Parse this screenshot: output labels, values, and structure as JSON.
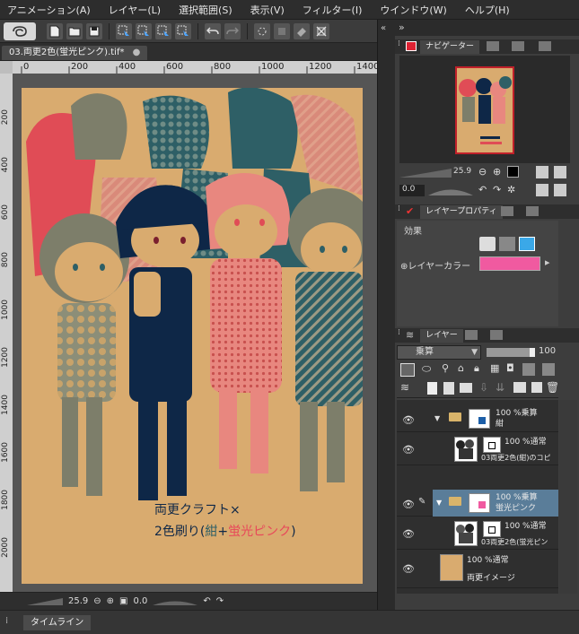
{
  "menu": [
    "アニメーション(A)",
    "レイヤー(L)",
    "選択範囲(S)",
    "表示(V)",
    "フィルター(I)",
    "ウインドウ(W)",
    "ヘルプ(H)"
  ],
  "document": {
    "tab_title": "03.両更2色(蛍光ピンク).tif*",
    "tab_close": "●"
  },
  "ruler_top_labels": [
    "0",
    "200",
    "400",
    "600",
    "800",
    "1000",
    "1200",
    "1400"
  ],
  "ruler_left_labels": [
    "200",
    "400",
    "600",
    "800",
    "1000",
    "1200",
    "1400",
    "1600",
    "1800",
    "2000"
  ],
  "artwork": {
    "line1": "両更クラフト×",
    "line2_prefix": "2色刷り(",
    "line2_navy": "紺",
    "line2_plus": "+",
    "line2_pink": "蛍光ピンク",
    "line2_suffix": ")",
    "colors": {
      "kraft": "#d9ab6f",
      "navy": "#0e2747",
      "pink": "#e86d70",
      "teal": "#2e5f66",
      "grey": "#8c8e78"
    }
  },
  "status": {
    "zoom": "25.9",
    "angle": "0.0"
  },
  "timeline_tab": "タイムライン",
  "navigator": {
    "tab": "ナビゲーター",
    "zoom": "25.9",
    "angle": "0.0"
  },
  "layer_property": {
    "tab": "レイヤープロパティ",
    "effect_label": "効果",
    "layer_color_label": "レイヤーカラー",
    "layer_color": "#f05aa0"
  },
  "layers": {
    "tab": "レイヤー",
    "blend_mode": "乗算",
    "opacity": "100",
    "items": [
      {
        "line1": "100 %乗算",
        "line2": "紺",
        "type": "folder",
        "expanded": true
      },
      {
        "line1": "100 %通常",
        "line2": "03両更2色(紺)のコピ",
        "type": "raster"
      },
      {
        "line1": "100 %乗算",
        "line2": "蛍光ピンク",
        "type": "folder",
        "expanded": true,
        "selected": true
      },
      {
        "line1": "100 %通常",
        "line2": "03両更2色(蛍光ピン",
        "type": "raster"
      },
      {
        "line1": "100 %通常",
        "line2": "両更イメージ",
        "type": "fill"
      }
    ]
  }
}
